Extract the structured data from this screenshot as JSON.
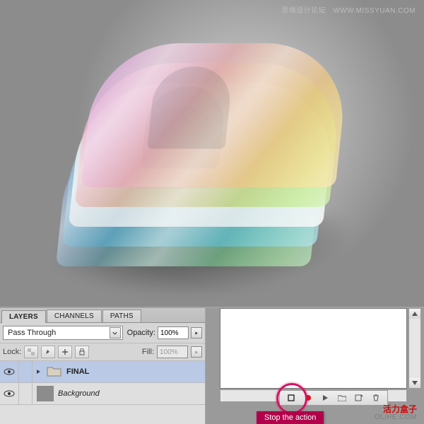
{
  "hero_watermark": {
    "cn": "思缘设计论坛",
    "url": "WWW.MISSYUAN.COM"
  },
  "panel": {
    "tabs": {
      "layers": "LAYERS",
      "channels": "CHANNELS",
      "paths": "PATHS"
    },
    "blend_mode": "Pass Through",
    "opacity_label": "Opacity:",
    "opacity_value": "100%",
    "lock_label": "Lock:",
    "fill_label": "Fill:",
    "fill_value": "100%",
    "layers": [
      {
        "name": "FINAL",
        "bold": true
      },
      {
        "name": "Background",
        "italic": true
      }
    ]
  },
  "callout_text": "Stop the action",
  "bottom_watermark": {
    "cn": "活力盒子",
    "en": "OLiHE.COM"
  }
}
